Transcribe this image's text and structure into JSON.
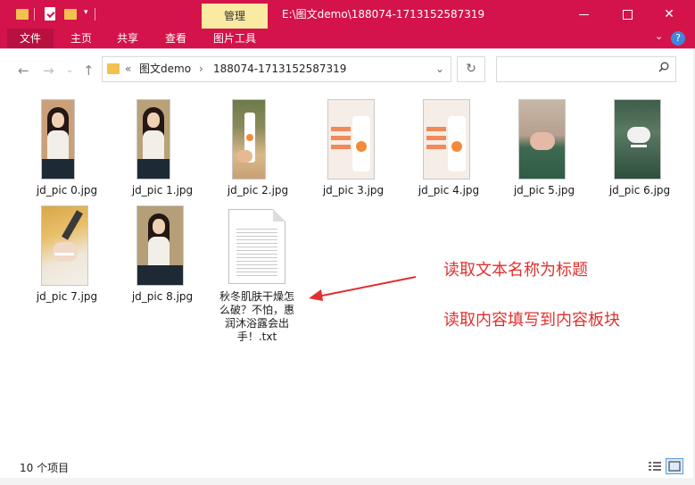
{
  "window": {
    "manage_tab": "管理",
    "path_title": "E:\\图文demo\\188074-1713152587319"
  },
  "ribbon": {
    "tabs": [
      "文件",
      "主页",
      "共享",
      "查看",
      "图片工具"
    ]
  },
  "address": {
    "prefix": "«",
    "crumbs": [
      "图文demo",
      "188074-1713152587319"
    ],
    "separator": "›"
  },
  "files": [
    {
      "name": "jd_pic 0.jpg",
      "kind": "person"
    },
    {
      "name": "jd_pic 1.jpg",
      "kind": "person"
    },
    {
      "name": "jd_pic 2.jpg",
      "kind": "product-hand"
    },
    {
      "name": "jd_pic 3.jpg",
      "kind": "product"
    },
    {
      "name": "jd_pic 4.jpg",
      "kind": "product"
    },
    {
      "name": "jd_pic 5.jpg",
      "kind": "hands-green"
    },
    {
      "name": "jd_pic 6.jpg",
      "kind": "foam-green"
    },
    {
      "name": "jd_pic 7.jpg",
      "kind": "pour"
    },
    {
      "name": "jd_pic 8.jpg",
      "kind": "person"
    },
    {
      "name_lines": [
        "秋冬肌肤干燥怎",
        "么破？不怕，惠",
        "润沐浴露会出",
        "手！.txt"
      ],
      "kind": "txt"
    }
  ],
  "annotations": {
    "line1": "读取文本名称为标题",
    "line2": "读取内容填写到内容板块",
    "color": "#e0312f"
  },
  "status": {
    "count": "10 个项目"
  },
  "colors": {
    "titlebar": "#d3134a",
    "manage_tab": "#fbeaa2",
    "folder": "#f2c14e"
  }
}
